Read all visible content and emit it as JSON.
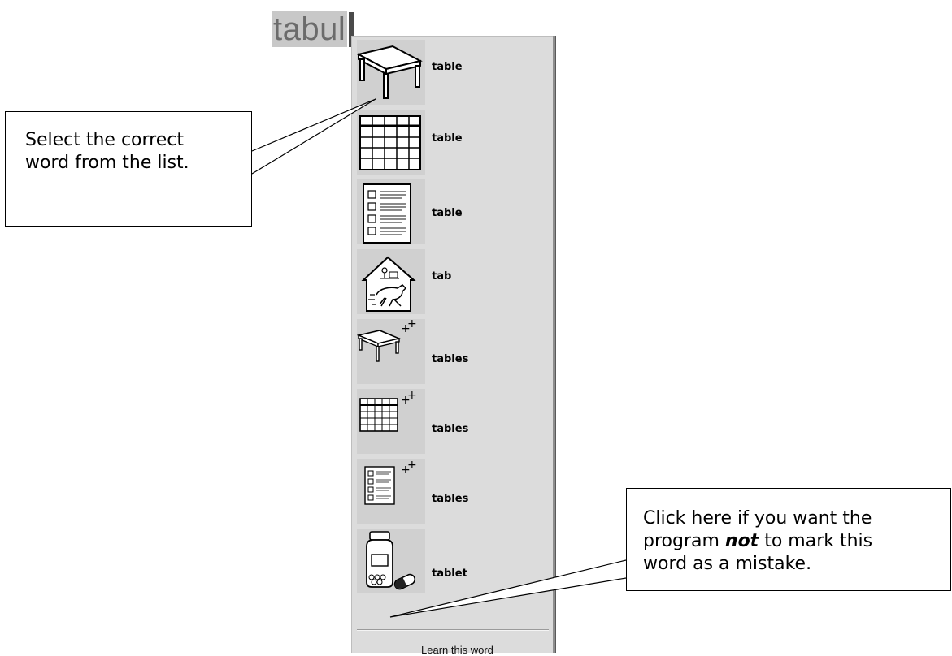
{
  "editor": {
    "typed_text": "tabul"
  },
  "menu": {
    "items": [
      {
        "word": "table",
        "icon": "table-furniture-icon"
      },
      {
        "word": "table",
        "icon": "grid-table-icon"
      },
      {
        "word": "table",
        "icon": "checklist-table-icon"
      },
      {
        "word": "tab",
        "icon": "horse-stable-icon"
      },
      {
        "word": "tables",
        "icon": "table-furniture-plural-icon"
      },
      {
        "word": "tables",
        "icon": "grid-table-plural-icon"
      },
      {
        "word": "tables",
        "icon": "checklist-table-plural-icon"
      },
      {
        "word": "tablet",
        "icon": "pill-bottle-icon"
      }
    ],
    "learn_label": "Learn this word"
  },
  "callouts": {
    "select": {
      "line1": "Select the correct",
      "line2": "word from the list."
    },
    "learn": {
      "line1": "Click here if you want the",
      "line2_pre": "program ",
      "line2_em": "not",
      "line2_post": " to mark this",
      "line3": "word as a mistake."
    }
  }
}
